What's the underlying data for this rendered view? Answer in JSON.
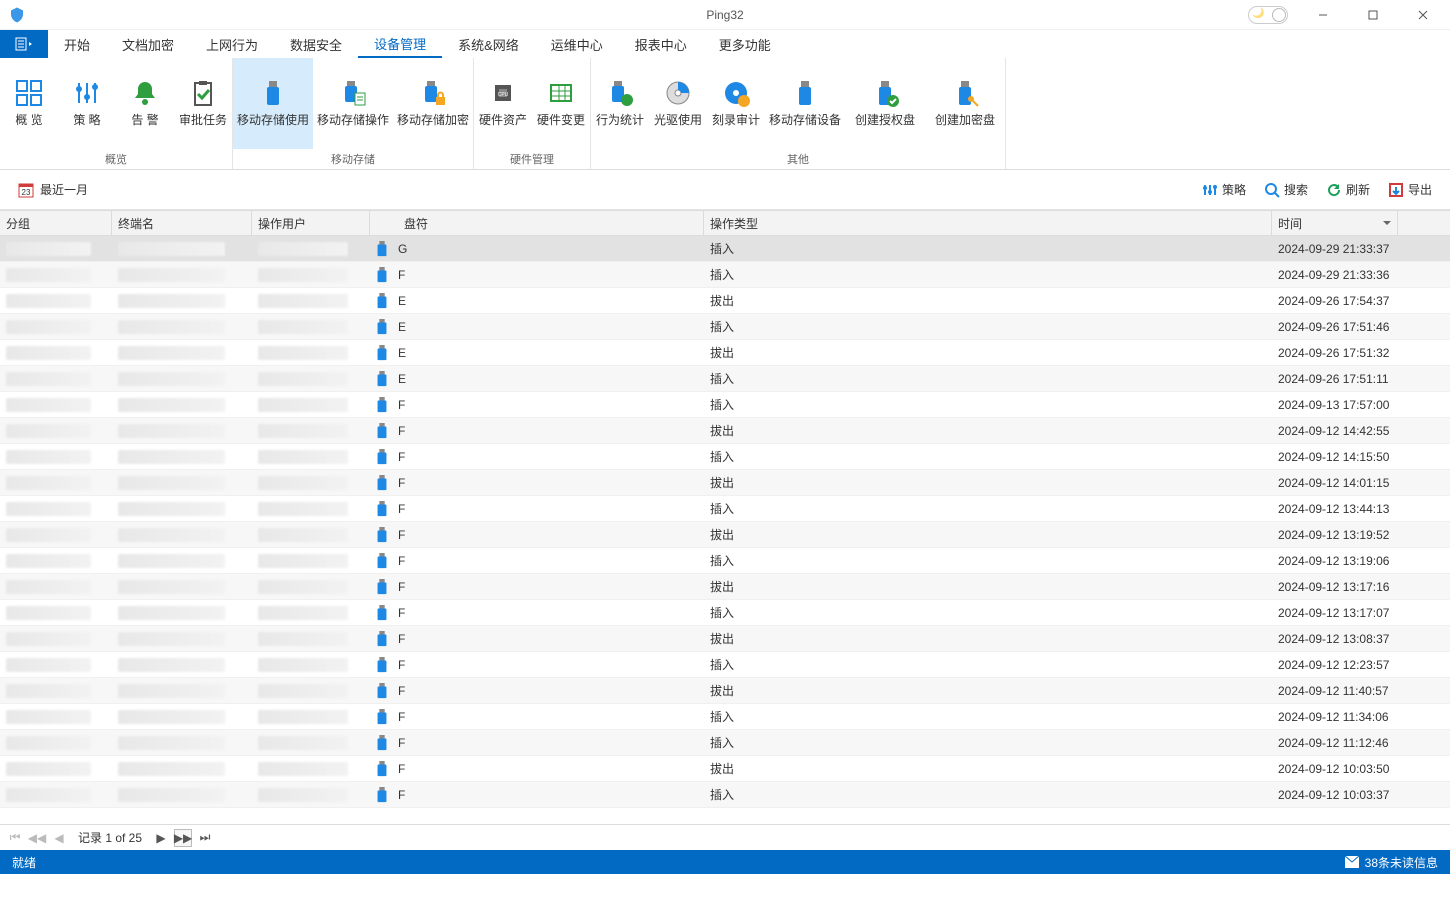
{
  "title": "Ping32",
  "menu": {
    "tabs": [
      "开始",
      "文档加密",
      "上网行为",
      "数据安全",
      "设备管理",
      "系统&网络",
      "运维中心",
      "报表中心",
      "更多功能"
    ],
    "active_index": 4
  },
  "ribbon": {
    "groups": [
      {
        "label": "概览",
        "buttons": [
          {
            "label": "概  览",
            "icon": "grid"
          },
          {
            "label": "策  略",
            "icon": "sliders"
          },
          {
            "label": "告  警",
            "icon": "bell"
          },
          {
            "label": "审批任务",
            "icon": "clipboard"
          }
        ]
      },
      {
        "label": "移动存储",
        "buttons": [
          {
            "label": "移动存储使用",
            "icon": "usb",
            "active": true
          },
          {
            "label": "移动存储操作",
            "icon": "usb-doc"
          },
          {
            "label": "移动存储加密",
            "icon": "usb-lock"
          }
        ]
      },
      {
        "label": "硬件管理",
        "buttons": [
          {
            "label": "硬件资产",
            "icon": "cpu"
          },
          {
            "label": "硬件变更",
            "icon": "table"
          }
        ]
      },
      {
        "label": "其他",
        "buttons": [
          {
            "label": "行为统计",
            "icon": "usb-chart"
          },
          {
            "label": "光驱使用",
            "icon": "disc"
          },
          {
            "label": "刻录审计",
            "icon": "disc-audit"
          },
          {
            "label": "移动存储设备",
            "icon": "usb-plain"
          },
          {
            "label": "创建授权盘",
            "icon": "usb-auth"
          },
          {
            "label": "创建加密盘",
            "icon": "usb-key"
          }
        ]
      }
    ]
  },
  "filter": {
    "range_label": "最近一月"
  },
  "toolbar_actions": [
    {
      "label": "策略",
      "icon": "sliders"
    },
    {
      "label": "搜索",
      "icon": "search"
    },
    {
      "label": "刷新",
      "icon": "refresh"
    },
    {
      "label": "导出",
      "icon": "export"
    }
  ],
  "grid": {
    "columns": [
      "分组",
      "终端名",
      "操作用户",
      "盘符",
      "操作类型",
      "时间"
    ],
    "rows": [
      {
        "drive": "G",
        "op": "插入",
        "time": "2024-09-29 21:33:37",
        "sel": true
      },
      {
        "drive": "F",
        "op": "插入",
        "time": "2024-09-29 21:33:36"
      },
      {
        "drive": "E",
        "op": "拔出",
        "time": "2024-09-26 17:54:37"
      },
      {
        "drive": "E",
        "op": "插入",
        "time": "2024-09-26 17:51:46"
      },
      {
        "drive": "E",
        "op": "拔出",
        "time": "2024-09-26 17:51:32"
      },
      {
        "drive": "E",
        "op": "插入",
        "time": "2024-09-26 17:51:11"
      },
      {
        "drive": "F",
        "op": "插入",
        "time": "2024-09-13 17:57:00"
      },
      {
        "drive": "F",
        "op": "拔出",
        "time": "2024-09-12 14:42:55"
      },
      {
        "drive": "F",
        "op": "插入",
        "time": "2024-09-12 14:15:50"
      },
      {
        "drive": "F",
        "op": "拔出",
        "time": "2024-09-12 14:01:15"
      },
      {
        "drive": "F",
        "op": "插入",
        "time": "2024-09-12 13:44:13"
      },
      {
        "drive": "F",
        "op": "拔出",
        "time": "2024-09-12 13:19:52"
      },
      {
        "drive": "F",
        "op": "插入",
        "time": "2024-09-12 13:19:06"
      },
      {
        "drive": "F",
        "op": "拔出",
        "time": "2024-09-12 13:17:16"
      },
      {
        "drive": "F",
        "op": "插入",
        "time": "2024-09-12 13:17:07"
      },
      {
        "drive": "F",
        "op": "拔出",
        "time": "2024-09-12 13:08:37"
      },
      {
        "drive": "F",
        "op": "插入",
        "time": "2024-09-12 12:23:57"
      },
      {
        "drive": "F",
        "op": "拔出",
        "time": "2024-09-12 11:40:57"
      },
      {
        "drive": "F",
        "op": "插入",
        "time": "2024-09-12 11:34:06"
      },
      {
        "drive": "F",
        "op": "插入",
        "time": "2024-09-12 11:12:46"
      },
      {
        "drive": "F",
        "op": "拔出",
        "time": "2024-09-12 10:03:50"
      },
      {
        "drive": "F",
        "op": "插入",
        "time": "2024-09-12 10:03:37"
      }
    ]
  },
  "pager": {
    "record_text": "记录 1 of 25"
  },
  "status": {
    "left": "就绪",
    "right": "38条未读信息"
  }
}
